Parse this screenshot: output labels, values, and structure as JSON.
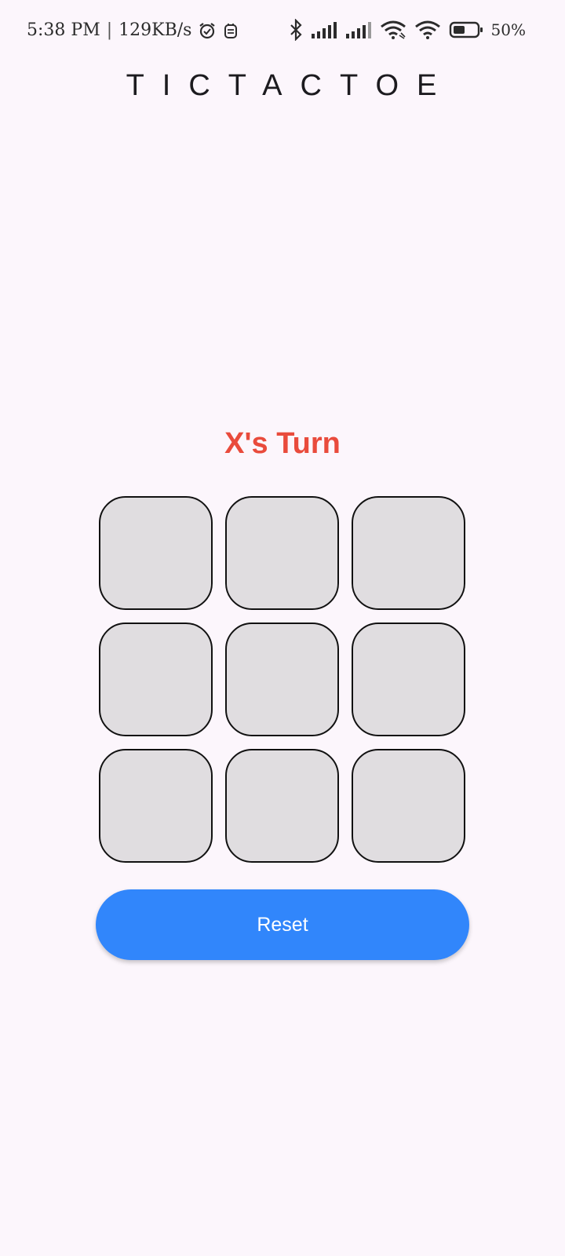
{
  "status_bar": {
    "time": "5:38 PM",
    "separator": "|",
    "network_speed": "129KB/s",
    "battery_percent": "50%",
    "icons": [
      "alarm-icon",
      "notification-icon",
      "bluetooth-icon",
      "signal-icon",
      "signal-icon",
      "wifi-icon",
      "wifi-icon",
      "battery-icon"
    ],
    "battery_level": 0.5
  },
  "app": {
    "title": "TICTACTOE"
  },
  "game": {
    "turn_text": "X's Turn",
    "turn_color": "#e94b3c",
    "board": [
      "",
      "",
      "",
      "",
      "",
      "",
      "",
      "",
      ""
    ],
    "cell_color": "#e0dde0"
  },
  "controls": {
    "reset_label": "Reset",
    "reset_color": "#3186fb"
  }
}
